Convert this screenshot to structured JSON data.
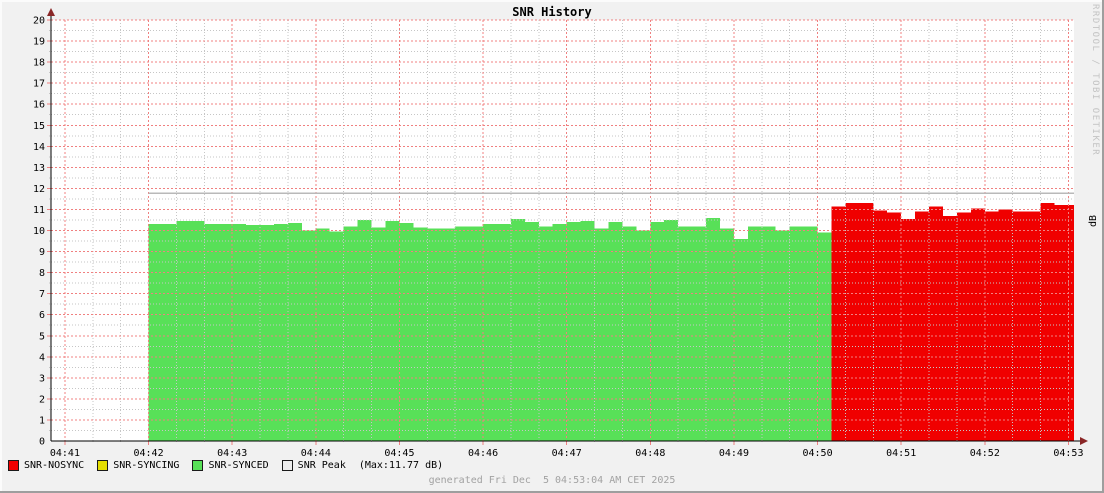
{
  "chart_data": {
    "type": "area",
    "title": "SNR History",
    "vertical_label": "dB",
    "watermark": "RRDTOOL / TOBI OETIKER",
    "ylim": [
      0,
      20
    ],
    "y_ticks": [
      0,
      1,
      2,
      3,
      4,
      5,
      6,
      7,
      8,
      9,
      10,
      11,
      12,
      13,
      14,
      15,
      16,
      17,
      18,
      19,
      20
    ],
    "y_minor_step": 0.5,
    "x_ticks": [
      "04:41",
      "04:42",
      "04:43",
      "04:44",
      "04:45",
      "04:46",
      "04:47",
      "04:48",
      "04:49",
      "04:50",
      "04:51",
      "04:52",
      "04:53"
    ],
    "x_axis": {
      "start": "04:40:50",
      "end": "04:53:04",
      "minor_step_s": 20
    },
    "grid": {
      "on": true,
      "major_color": "#f08080",
      "minor_color": "#c6c6c6"
    },
    "axis_color": "#000000",
    "arrow_color": "#8a2727",
    "canvas_color": "#ffffff",
    "series": [
      {
        "name": "SNR-SYNCED",
        "type": "area",
        "color": "#58e058",
        "start": "04:42:00",
        "step_s": 10,
        "values": [
          10.3,
          10.3,
          10.45,
          10.45,
          10.3,
          10.3,
          10.3,
          10.25,
          10.25,
          10.3,
          10.35,
          10.0,
          10.1,
          9.95,
          10.2,
          10.5,
          10.15,
          10.45,
          10.35,
          10.15,
          10.1,
          10.1,
          10.2,
          10.2,
          10.3,
          10.3,
          10.55,
          10.4,
          10.2,
          10.3,
          10.4,
          10.45,
          10.1,
          10.4,
          10.2,
          10.0,
          10.4,
          10.5,
          10.2,
          10.2,
          10.6,
          10.1,
          9.6,
          10.2,
          10.2,
          10.0,
          10.2,
          10.2,
          9.9
        ]
      },
      {
        "name": "SNR-NOSYNC",
        "type": "area",
        "color": "#f00000",
        "start": "04:50:10",
        "step_s": 10,
        "values": [
          11.15,
          11.3,
          11.3,
          10.95,
          10.85,
          10.55,
          10.9,
          11.15,
          10.7,
          10.85,
          11.05,
          10.9,
          11.0,
          10.9,
          10.9,
          11.3,
          11.2,
          11.2
        ]
      },
      {
        "name": "SNR Peak",
        "type": "line",
        "color": "#b9b9b9",
        "start": "04:42:00",
        "end": "04:53:04",
        "value": 11.77
      }
    ]
  },
  "legend": {
    "items": [
      {
        "label": "SNR-NOSYNC",
        "color": "#f00000"
      },
      {
        "label": "SNR-SYNCING",
        "color": "#e5de00"
      },
      {
        "label": "SNR-SYNCED",
        "color": "#58e058"
      },
      {
        "label": "SNR Peak",
        "color": "#ececec"
      }
    ],
    "max_label": "(Max:11.77 dB)"
  },
  "footer": {
    "generated": "generated Fri Dec  5 04:53:04 AM CET 2025"
  }
}
